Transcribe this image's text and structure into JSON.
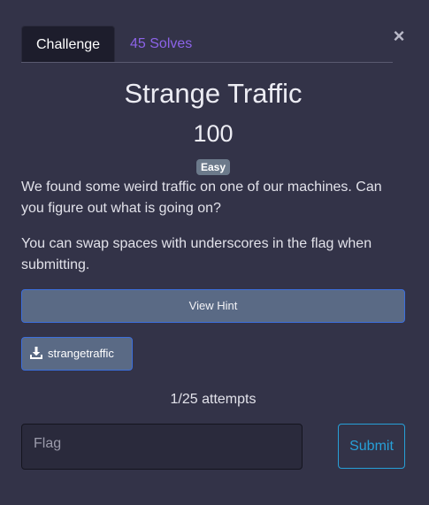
{
  "tabs": {
    "challenge_label": "Challenge",
    "solves_label": "45 Solves"
  },
  "challenge": {
    "title": "Strange Traffic",
    "points": "100",
    "difficulty": "Easy",
    "description_1": "We found some weird traffic on one of our machines. Can you figure out what is going on?",
    "description_2": "You can swap spaces with underscores in the flag when submitting."
  },
  "buttons": {
    "view_hint": "View Hint",
    "file_name": "strangetraffic",
    "submit": "Submit",
    "close": "×"
  },
  "attempts": "1/25 attempts",
  "flag": {
    "placeholder": "Flag",
    "value": ""
  },
  "icons": {
    "close": "close-icon",
    "download": "download-icon"
  },
  "colors": {
    "background": "#333348",
    "link": "#8c63e8",
    "button": "#5a6a85",
    "button_border": "#3c6fdc",
    "submit": "#27a0d8",
    "badge": "#6c7a8b"
  }
}
